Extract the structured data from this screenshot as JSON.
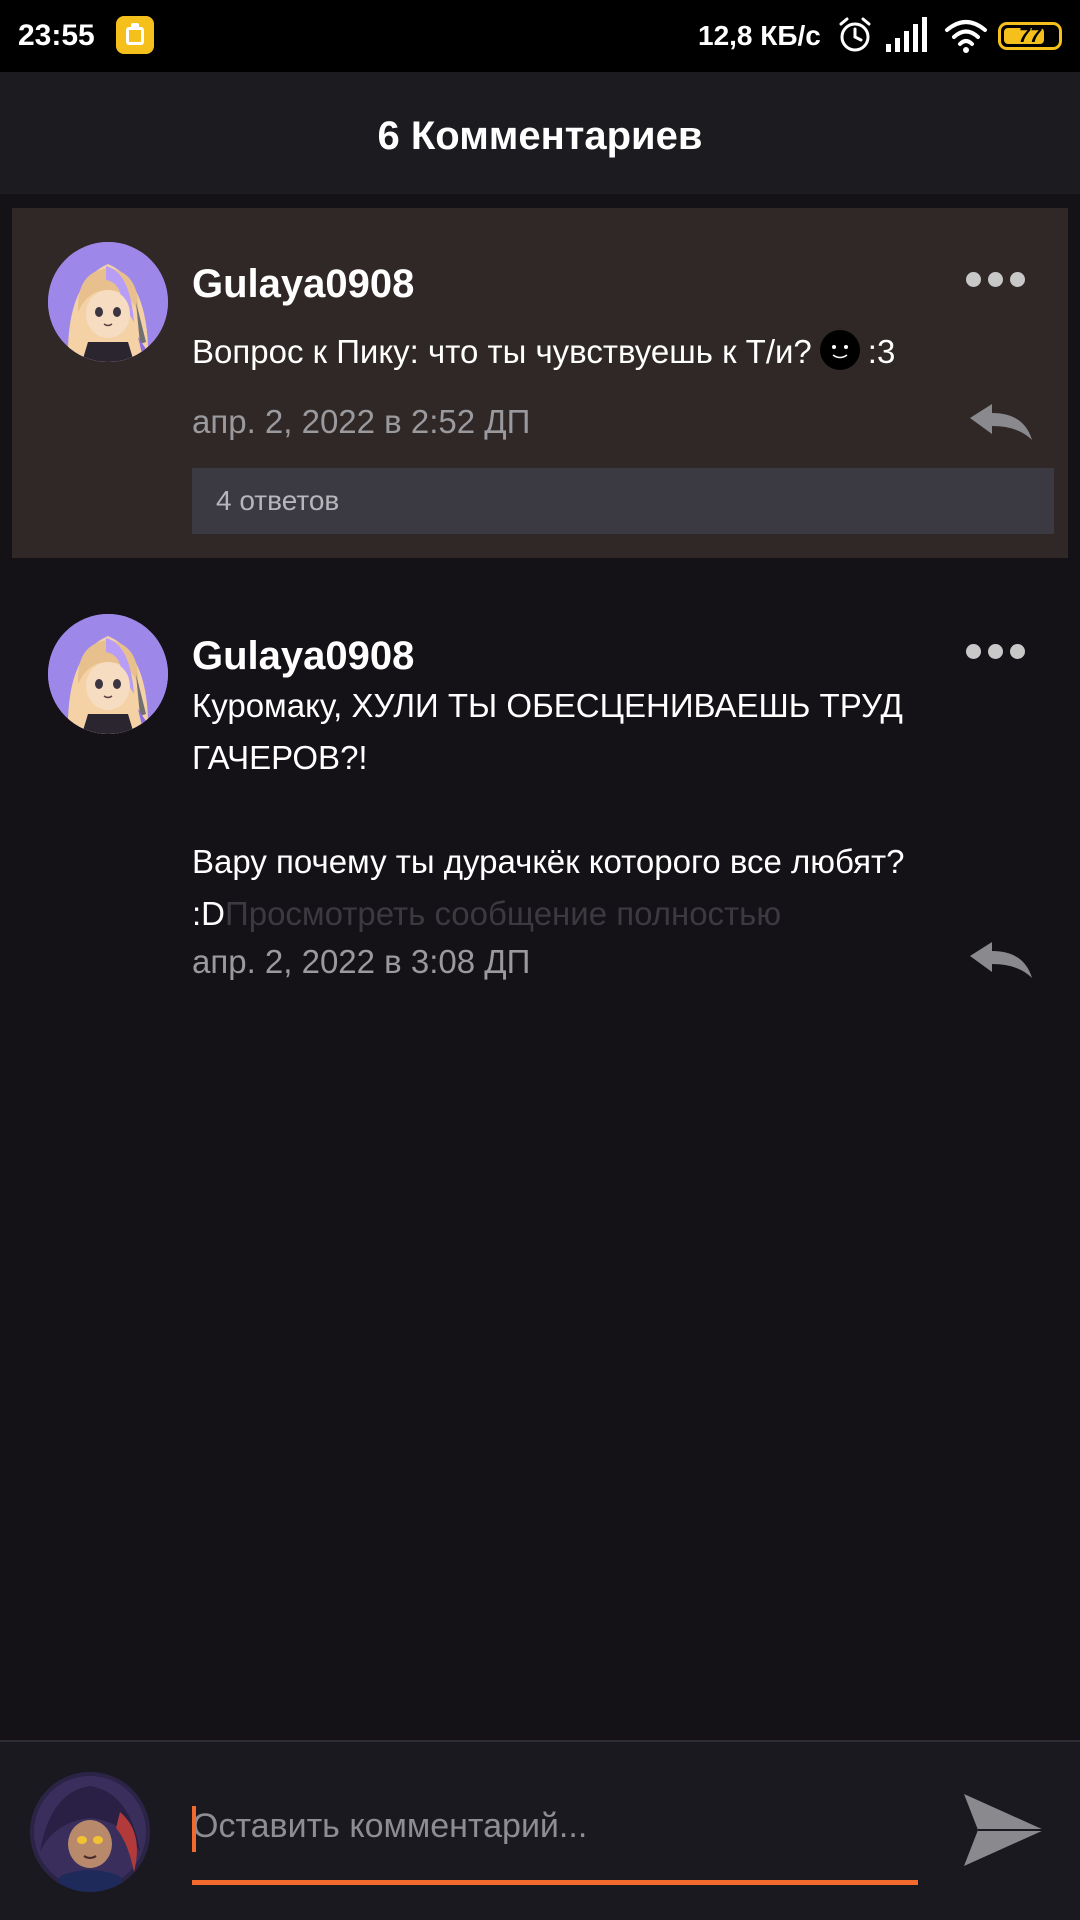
{
  "status_bar": {
    "time": "23:55",
    "network_speed": "12,8 КБ/с",
    "battery_level": "77",
    "battery_fraction": 0.77,
    "icons": [
      "app-notification-icon",
      "alarm-icon",
      "signal-icon",
      "wifi-icon",
      "battery-icon"
    ]
  },
  "header": {
    "title": "6 Комментариев"
  },
  "comments": [
    {
      "username": "Gulaya0908",
      "text_before_emoji": "Вопрос к Пику: что ты чувствуешь к Т/и?",
      "text_after_emoji": ":3",
      "timestamp": "апр. 2, 2022 в 2:52 ДП",
      "replies_label": "4 ответов",
      "highlighted": true
    },
    {
      "username": "Gulaya0908",
      "text_line_1": "Куромаку, ХУЛИ ТЫ ОБЕСЦЕНИВАЕШЬ ТРУД ГАЧЕРОВ?!",
      "text_line_2": "Вару почему ты дурачкёк которого все любят? :D",
      "view_full_label": "Просмотреть сообщение полностью",
      "timestamp": "апр. 2, 2022 в 3:08 ДП",
      "highlighted": false
    }
  ],
  "composer": {
    "placeholder": "Оставить комментарий..."
  },
  "colors": {
    "accent": "#f26a2e",
    "background": "#141217",
    "highlight": "#2f2826",
    "battery": "#f5c01b"
  }
}
